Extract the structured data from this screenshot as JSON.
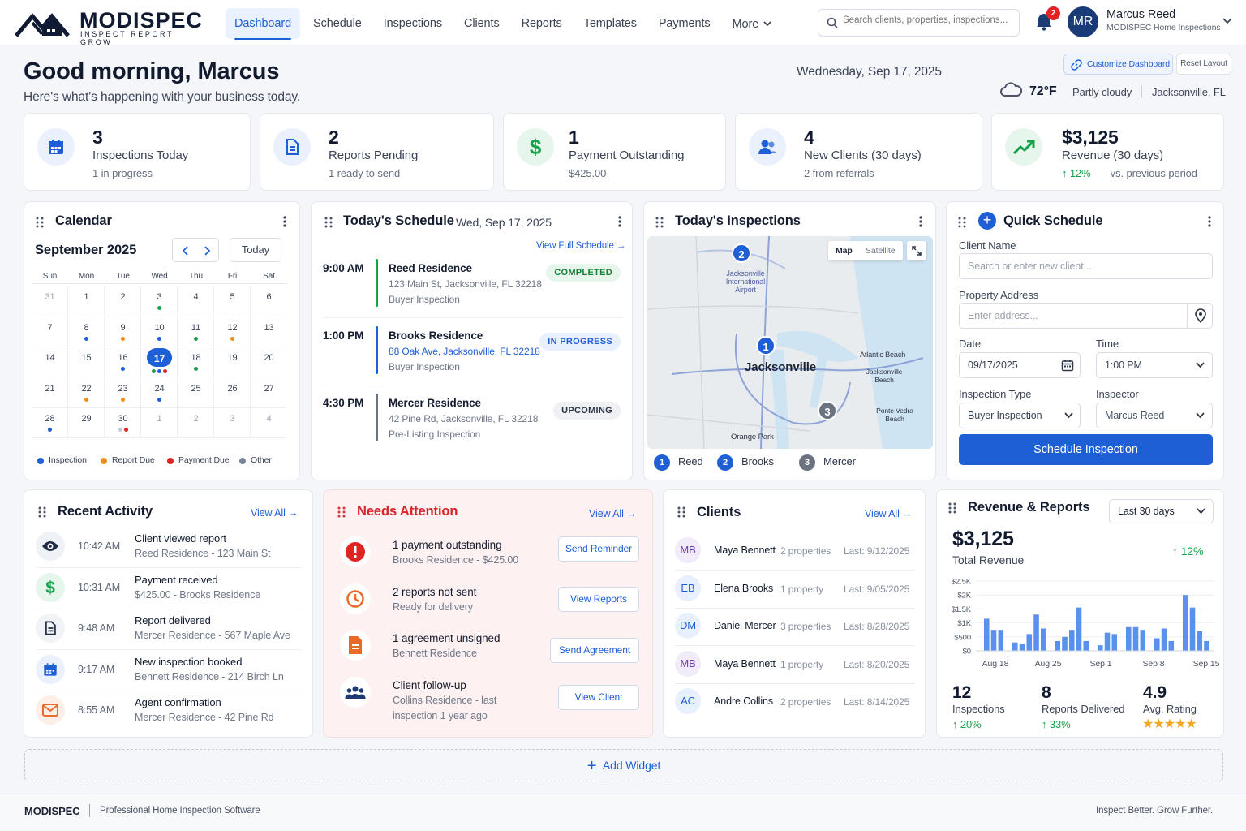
{
  "brand": {
    "name": "MODISPEC",
    "tagline": "INSPECT  REPORT  GROW"
  },
  "nav": {
    "items": [
      "Dashboard",
      "Schedule",
      "Inspections",
      "Clients",
      "Reports",
      "Templates",
      "Payments",
      "More"
    ],
    "active": "Dashboard"
  },
  "search": {
    "placeholder": "Search clients, properties, inspections..."
  },
  "notifications": {
    "count": "2"
  },
  "user": {
    "initials": "MR",
    "name": "Marcus Reed",
    "org": "MODISPEC Home Inspections"
  },
  "header": {
    "greeting": "Good morning, Marcus",
    "subtitle": "Here's what's happening with your business today.",
    "date": "Wednesday, Sep 17, 2025",
    "customize_label": "Customize Dashboard",
    "reset_label": "Reset Layout",
    "weather": {
      "temp": "72°F",
      "condition": "Partly cloudy",
      "location": "Jacksonville, FL"
    }
  },
  "stats": [
    {
      "value": "3",
      "label": "Inspections Today",
      "sub": "1 in progress",
      "icon": "calendar-icon",
      "color": "#1f5fd6"
    },
    {
      "value": "2",
      "label": "Reports Pending",
      "sub": "1 ready to send",
      "icon": "document-icon",
      "color": "#1f5fd6"
    },
    {
      "value": "1",
      "label": "Payment Outstanding",
      "sub": "$425.00",
      "icon": "dollar-icon",
      "color": "#16a34a"
    },
    {
      "value": "4",
      "label": "New Clients (30 days)",
      "sub": "2 from referrals",
      "icon": "users-icon",
      "color": "#1f5fd6"
    },
    {
      "value": "$3,125",
      "label": "Revenue (30 days)",
      "sub_change": "12%",
      "sub_note": "vs. previous period",
      "icon": "trend-up-icon",
      "color": "#16a34a"
    }
  ],
  "calendar": {
    "title": "Calendar",
    "month": "September 2025",
    "today_label": "Today",
    "weekdays": [
      "Sun",
      "Mon",
      "Tue",
      "Wed",
      "Thu",
      "Fri",
      "Sat"
    ],
    "weeks": [
      [
        "31",
        "1",
        "2",
        "3",
        "4",
        "5",
        "6"
      ],
      [
        "7",
        "8",
        "9",
        "10",
        "11",
        "12",
        "13"
      ],
      [
        "14",
        "15",
        "16",
        "17",
        "18",
        "19",
        "20"
      ],
      [
        "21",
        "22",
        "23",
        "24",
        "25",
        "26",
        "27"
      ],
      [
        "28",
        "29",
        "30",
        "1",
        "2",
        "3",
        "4"
      ]
    ],
    "selected": "17",
    "legend": [
      {
        "label": "Inspection",
        "color": "#1f5fd6"
      },
      {
        "label": "Report Due",
        "color": "#f08c1c"
      },
      {
        "label": "Payment Due",
        "color": "#e02424"
      },
      {
        "label": "Other",
        "color": "#7b8494"
      }
    ]
  },
  "schedule": {
    "title": "Today's Schedule",
    "date": "Wed, Sep 17, 2025",
    "view_all": "View Full Schedule",
    "items": [
      {
        "time": "9:00 AM",
        "name": "Reed Residence",
        "address": "123 Main St, Jacksonville, FL 32218",
        "type": "Buyer Inspection",
        "status": "COMPLETED",
        "bar": "#16a34a"
      },
      {
        "time": "1:00 PM",
        "name": "Brooks Residence",
        "address": "88 Oak Ave, Jacksonville, FL 32218",
        "type": "Buyer Inspection",
        "status": "IN PROGRESS",
        "bar": "#1f5fd6"
      },
      {
        "time": "4:30 PM",
        "name": "Mercer Residence",
        "address": "42 Pine Rd, Jacksonville, FL 32218",
        "type": "Pre-Listing Inspection",
        "status": "UPCOMING",
        "bar": "#6b7280"
      }
    ]
  },
  "inspections_map": {
    "title": "Today's Inspections",
    "map_label": "Map",
    "satellite_label": "Satellite",
    "places": [
      "Jacksonville International Airport",
      "Jacksonville",
      "Atlantic Beach",
      "Jacksonville Beach",
      "Ponte Vedra Beach",
      "Orange Park"
    ],
    "legend": [
      {
        "num": "1",
        "name": "Reed",
        "color": "#1f5fd6"
      },
      {
        "num": "2",
        "name": "Brooks",
        "color": "#1f5fd6"
      },
      {
        "num": "3",
        "name": "Mercer",
        "color": "#6b7280"
      }
    ]
  },
  "quick_schedule": {
    "title": "Quick Schedule",
    "client_label": "Client Name",
    "client_placeholder": "Search or enter new client...",
    "address_label": "Property Address",
    "address_placeholder": "Enter address...",
    "date_label": "Date",
    "date_value": "09/17/2025",
    "time_label": "Time",
    "time_value": "1:00 PM",
    "type_label": "Inspection Type",
    "type_value": "Buyer Inspection",
    "inspector_label": "Inspector",
    "inspector_value": "Marcus Reed",
    "submit": "Schedule Inspection"
  },
  "activity": {
    "title": "Recent Activity",
    "view_all": "View All",
    "items": [
      {
        "time": "10:42 AM",
        "title": "Client viewed report",
        "sub": "Reed Residence - 123 Main St",
        "icon": "eye-icon"
      },
      {
        "time": "10:31 AM",
        "title": "Payment received",
        "sub": "$425.00 - Brooks Residence",
        "icon": "dollar-icon"
      },
      {
        "time": "9:48 AM",
        "title": "Report delivered",
        "sub": "Mercer Residence - 567 Maple Ave",
        "icon": "document-icon"
      },
      {
        "time": "9:17 AM",
        "title": "New inspection booked",
        "sub": "Bennett Residence - 214 Birch Ln",
        "icon": "calendar-icon"
      },
      {
        "time": "8:55 AM",
        "title": "Agent confirmation",
        "sub": "Mercer Residence - 42 Pine Rd",
        "icon": "mail-icon"
      }
    ]
  },
  "attention": {
    "title": "Needs Attention",
    "view_all": "View All",
    "items": [
      {
        "title": "1 payment outstanding",
        "sub": "Brooks Residence  -  $425.00",
        "action": "Send Reminder",
        "icon": "alert-icon"
      },
      {
        "title": "2 reports not sent",
        "sub": "Ready for delivery",
        "action": "View Reports",
        "icon": "clock-icon"
      },
      {
        "title": "1 agreement unsigned",
        "sub": "Bennett Residence",
        "action": "Send Agreement",
        "icon": "file-icon"
      },
      {
        "title": "Client follow-up",
        "sub": "Collins Residence - last",
        "sub2": "inspection 1 year ago",
        "action": "View Client",
        "icon": "group-icon"
      }
    ]
  },
  "clients": {
    "title": "Clients",
    "view_all": "View All",
    "items": [
      {
        "initials": "MB",
        "name": "Maya Bennett",
        "props": "2 properties",
        "last": "Last: 9/12/2025"
      },
      {
        "initials": "EB",
        "name": "Elena Brooks",
        "props": "1 property",
        "last": "Last: 9/05/2025"
      },
      {
        "initials": "DM",
        "name": "Daniel Mercer",
        "props": "3 properties",
        "last": "Last: 8/28/2025"
      },
      {
        "initials": "MB",
        "name": "Maya Bennett",
        "props": "1 property",
        "last": "Last: 8/20/2025"
      },
      {
        "initials": "AC",
        "name": "Andre Collins",
        "props": "2 properties",
        "last": "Last: 8/14/2025"
      }
    ]
  },
  "revenue": {
    "title": "Revenue & Reports",
    "range": "Last 30 days",
    "total": "$3,125",
    "total_label": "Total Revenue",
    "change": "12%",
    "metrics": [
      {
        "value": "12",
        "label": "Inspections",
        "change": "20%"
      },
      {
        "value": "8",
        "label": "Reports Delivered",
        "change": "33%"
      },
      {
        "value": "4.9",
        "label": "Avg. Rating",
        "stars": 5
      }
    ]
  },
  "chart_data": {
    "type": "bar",
    "yticks": [
      "$2.5K",
      "$2K",
      "$1.5K",
      "$1K",
      "$500",
      "$0"
    ],
    "ylim": [
      0,
      2500
    ],
    "xticks": [
      "Aug 18",
      "Aug 25",
      "Sep 1",
      "Sep 8",
      "Sep 15"
    ],
    "values": [
      1150,
      750,
      750,
      0,
      300,
      250,
      600,
      1300,
      800,
      0,
      350,
      500,
      750,
      1550,
      350,
      0,
      200,
      650,
      600,
      0,
      850,
      850,
      750,
      0,
      450,
      800,
      350,
      0,
      2000,
      1550,
      700,
      350
    ]
  },
  "add_widget": "Add Widget",
  "footer": {
    "brand": "MODISPEC",
    "tagline": "Professional Home Inspection Software",
    "right": "Inspect Better.  Grow Further."
  }
}
